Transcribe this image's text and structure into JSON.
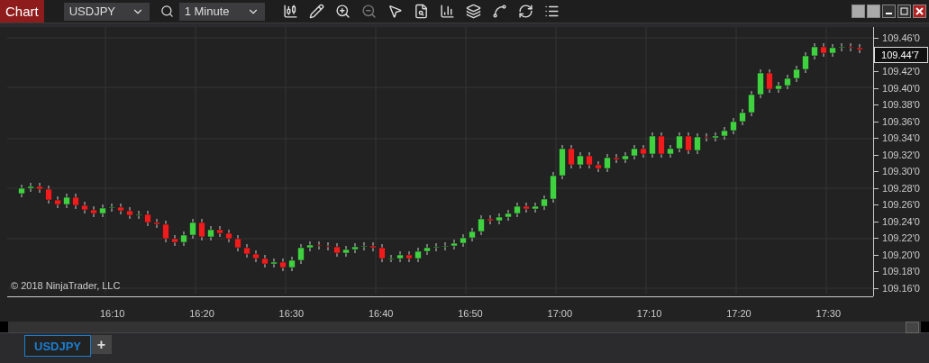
{
  "toolbar": {
    "title": "Chart",
    "instrument": "USDJPY",
    "interval": "1 Minute"
  },
  "price_axis": {
    "ticks": [
      {
        "kind": "tick",
        "label": "109.46'0"
      },
      {
        "kind": "current",
        "label": "109.44'7"
      },
      {
        "kind": "tick",
        "label": "109.42'0"
      },
      {
        "kind": "tick",
        "label": "109.40'0"
      },
      {
        "kind": "tick",
        "label": "109.38'0"
      },
      {
        "kind": "tick",
        "label": "109.36'0"
      },
      {
        "kind": "tick",
        "label": "109.34'0"
      },
      {
        "kind": "tick",
        "label": "109.32'0"
      },
      {
        "kind": "tick",
        "label": "109.30'0"
      },
      {
        "kind": "tick",
        "label": "109.28'0"
      },
      {
        "kind": "tick",
        "label": "109.26'0"
      },
      {
        "kind": "tick",
        "label": "109.24'0"
      },
      {
        "kind": "tick",
        "label": "109.22'0"
      },
      {
        "kind": "tick",
        "label": "109.20'0"
      },
      {
        "kind": "tick",
        "label": "109.18'0"
      },
      {
        "kind": "tick",
        "label": "109.16'0"
      }
    ]
  },
  "time_axis": {
    "ticks": [
      "16:10",
      "16:20",
      "16:30",
      "16:40",
      "16:50",
      "17:00",
      "17:10",
      "17:20",
      "17:30"
    ]
  },
  "copyright": "© 2018 NinjaTrader, LLC",
  "tabs": [
    {
      "label": "USDJPY",
      "selected": true
    }
  ],
  "add_tab": "+"
}
